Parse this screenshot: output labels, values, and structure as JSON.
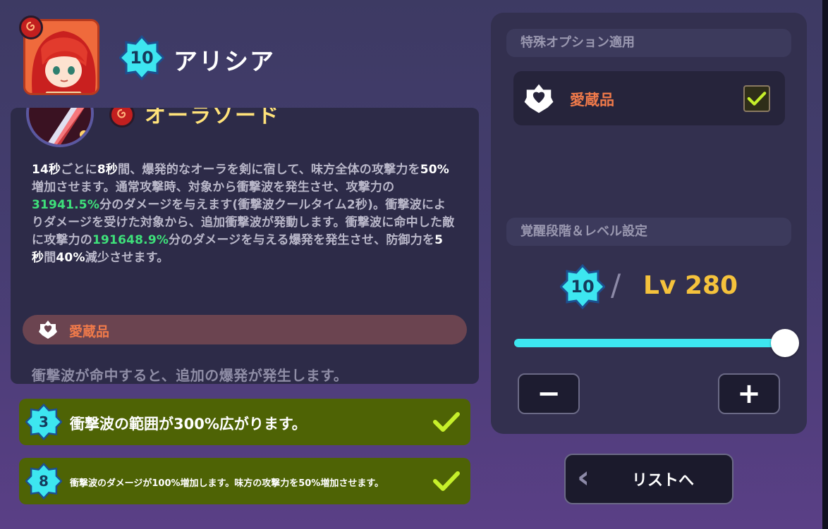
{
  "character": {
    "name": "アリシア",
    "awakening": "10"
  },
  "skill": {
    "name": "オーラソード",
    "desc": {
      "p1": "14秒",
      "p2": "ごとに",
      "p3": "8秒",
      "p4": "間、爆発的なオーラを剣に宿して、味方全体の攻撃力を",
      "p5": "50%",
      "p6": "増加させます。通常攻撃時、対象から衝撃波を発生させ、攻撃力の",
      "p7": "31941.5%",
      "p8": "分のダメージを与えます(衝撃波クールタイム2秒)。衝撃波によりダメージを受けた対象から、追加衝撃波が発動します。衝撃波に命中した敵に攻撃力の",
      "p9": "191648.9%",
      "p10": "分のダメージを与える爆発を発生させ、防御力を",
      "p11": "5秒",
      "p12": "間",
      "p13": "40%",
      "p14": "減少させます。"
    }
  },
  "treasure": {
    "label": "愛蔵品",
    "effect": "衝撃波が命中すると、追加の爆発が発生します。"
  },
  "options": [
    {
      "level": "3",
      "text": "衝撃波の範囲が300%広がります。",
      "checked": true
    },
    {
      "level": "8",
      "text": "衝撃波のダメージが100%増加します。味方の攻撃力を50%増加させます。",
      "checked": true
    }
  ],
  "right_panel": {
    "special_header": "特殊オプション適用",
    "treasure_toggle_label": "愛蔵品",
    "treasure_checked": true,
    "level_header": "覚醒段階＆レベル設定",
    "awakening": "10",
    "slash": "/",
    "level_text": "Lv 280",
    "level_slider_fraction": 1.0,
    "minus_label": "−",
    "plus_label": "+"
  },
  "back_button": {
    "arrow": "‹",
    "label": "リストへ"
  },
  "colors": {
    "accent_cyan": "#3de6f0",
    "level_gold": "#f5c23c",
    "treasure_orange": "#f07a4a",
    "check_green": "#c6f02a",
    "option_green": "#4e6305"
  }
}
